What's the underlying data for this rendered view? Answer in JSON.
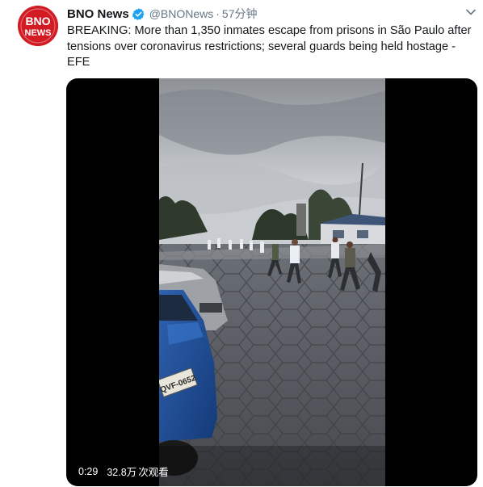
{
  "tweet": {
    "avatar_text": [
      "BNO",
      "NEWS"
    ],
    "display_name": "BNO News",
    "handle": "@BNONews",
    "separator": "·",
    "time": "57分钟",
    "text": "BREAKING: More than 1,350 inmates escape from prisons in São Paulo after tensions over coronavirus restrictions; several guards being held hostage - EFE",
    "icons": {
      "verified": "verified-badge-icon",
      "more": "chevron-down-icon"
    }
  },
  "video": {
    "duration": "0:29",
    "views": "32.8万",
    "views_suffix": "次观看",
    "license_plate": "QVF-0652"
  },
  "colors": {
    "brand_red": "#d21b23",
    "verified_blue": "#1da1f2",
    "text_primary": "#14171a",
    "text_secondary": "#657786"
  }
}
